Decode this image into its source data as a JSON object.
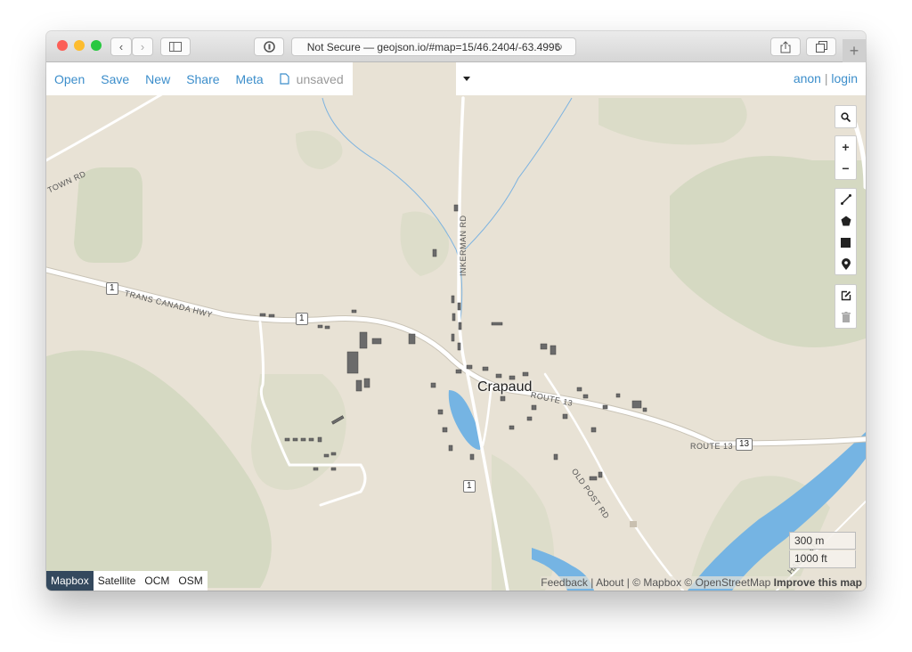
{
  "browser": {
    "url_text": "Not Secure — geojson.io/#map=15/46.2404/-63.4996",
    "icons": [
      "back-icon",
      "forward-icon",
      "sidebar-icon",
      "password-icon",
      "reload-icon",
      "share-icon",
      "tabs-icon",
      "new-tab-icon"
    ],
    "new_tab_label": "+"
  },
  "toolbar": {
    "menu": [
      "Open",
      "Save",
      "New",
      "Share",
      "Meta"
    ],
    "file_status": "unsaved",
    "user": "anon",
    "separator": "|",
    "login": "login"
  },
  "map_controls": {
    "search": "search-icon",
    "zoom_in": "+",
    "zoom_out": "−",
    "draw_tools": [
      "draw-line-icon",
      "draw-polygon-icon",
      "draw-rectangle-icon",
      "draw-marker-icon"
    ],
    "edit_tools": [
      "edit-icon",
      "delete-icon"
    ]
  },
  "layers": {
    "options": [
      "Mapbox",
      "Satellite",
      "OCM",
      "OSM"
    ],
    "active": "Mapbox"
  },
  "scale": {
    "metric": "300 m",
    "imperial": "1000 ft"
  },
  "attribution": {
    "feedback": "Feedback",
    "sep": " | ",
    "about": "About",
    "copyright": " | © Mapbox © OpenStreetMap ",
    "improve": "Improve this map"
  },
  "map_labels": {
    "town": "Crapaud",
    "roads": {
      "town_rd": "TOWN RD",
      "trans_canada": "TRANS CANADA HWY",
      "inkerman": "INKERMAN RD",
      "route13a": "ROUTE 13",
      "route13b": "ROUTE 13",
      "old_post": "OLD POST RD",
      "halls": "HALLS LN"
    },
    "shields": {
      "hwy1a": "1",
      "hwy1b": "1",
      "hwy1c": "1",
      "route13": "13"
    }
  },
  "colors": {
    "link": "#3c8ecb",
    "land": "#e8e2d5",
    "water": "#75b4e3",
    "park": "#d3d8c0",
    "layer_active": "#34495e"
  }
}
